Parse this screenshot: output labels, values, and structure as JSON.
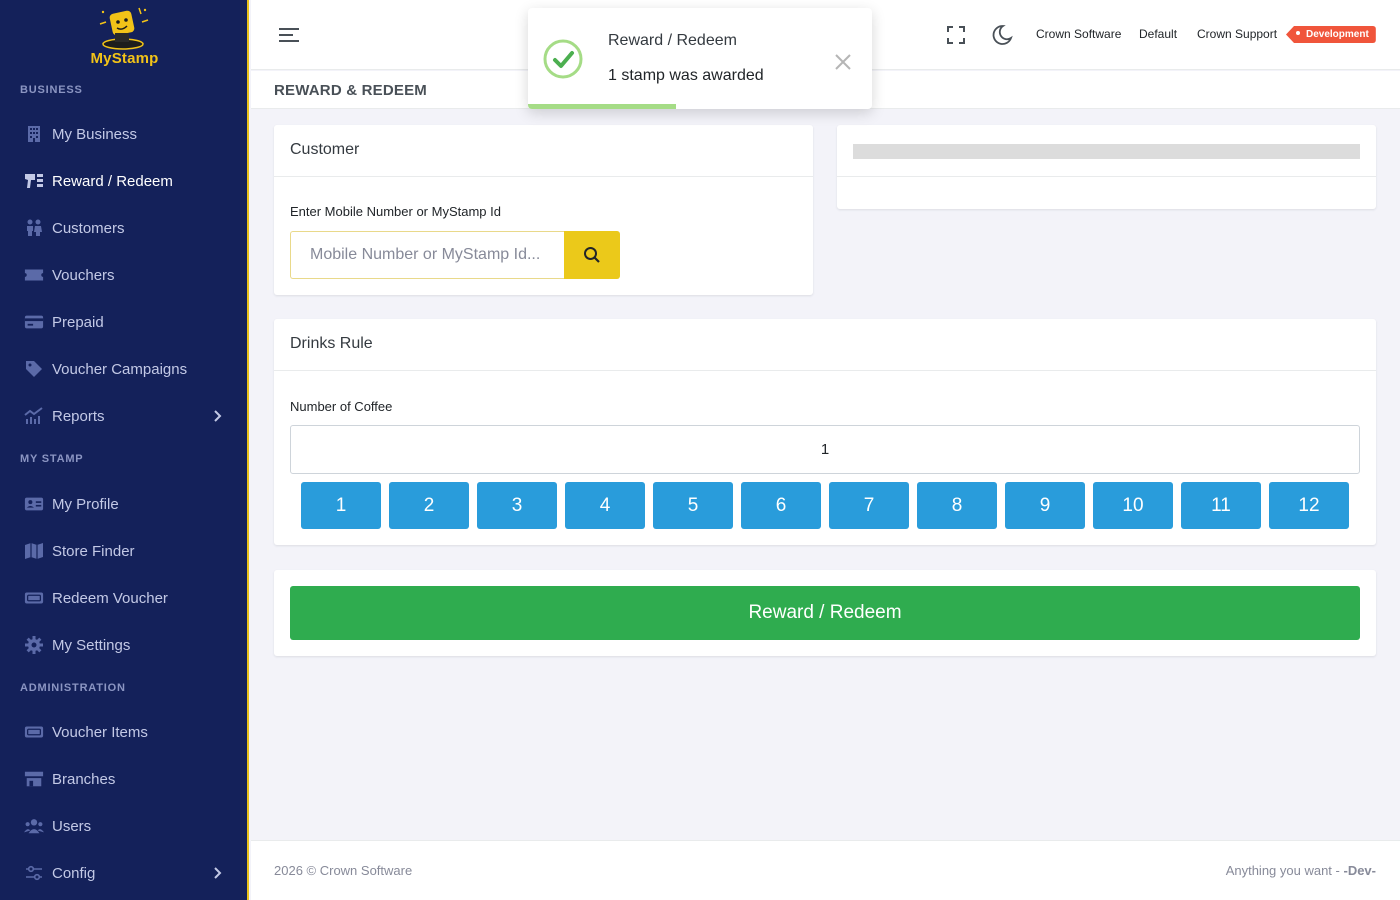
{
  "brand": {
    "name": "MyStamp"
  },
  "sidebar": {
    "sections": [
      {
        "title": "BUSINESS"
      },
      {
        "title": "MY STAMP"
      },
      {
        "title": "ADMINISTRATION"
      }
    ],
    "items": [
      {
        "label": "My Business",
        "icon": "building-icon"
      },
      {
        "label": "Reward / Redeem",
        "icon": "stamp-icon",
        "active": true
      },
      {
        "label": "Customers",
        "icon": "users-icon"
      },
      {
        "label": "Vouchers",
        "icon": "ticket-icon"
      },
      {
        "label": "Prepaid",
        "icon": "credit-card-icon"
      },
      {
        "label": "Voucher Campaigns",
        "icon": "tag-icon"
      },
      {
        "label": "Reports",
        "icon": "chart-icon",
        "has_submenu": true
      },
      {
        "label": "My Profile",
        "icon": "id-card-icon"
      },
      {
        "label": "Store Finder",
        "icon": "map-icon"
      },
      {
        "label": "Redeem Voucher",
        "icon": "ticket-icon"
      },
      {
        "label": "My Settings",
        "icon": "gear-icon"
      },
      {
        "label": "Voucher Items",
        "icon": "ticket-icon"
      },
      {
        "label": "Branches",
        "icon": "store-icon"
      },
      {
        "label": "Users",
        "icon": "users-icon"
      },
      {
        "label": "Config",
        "icon": "sliders-icon",
        "has_submenu": true
      }
    ]
  },
  "topbar": {
    "links": [
      "Crown Software",
      "Default",
      "Crown Support"
    ],
    "badge": "Development"
  },
  "page": {
    "title": "REWARD & REDEEM"
  },
  "customer_card": {
    "title": "Customer",
    "label": "Enter Mobile Number or MyStamp Id",
    "placeholder": "Mobile Number or MyStamp Id..."
  },
  "rule_card": {
    "title": "Drinks Rule",
    "label": "Number of Coffee",
    "value": "1",
    "options": [
      "1",
      "2",
      "3",
      "4",
      "5",
      "6",
      "7",
      "8",
      "9",
      "10",
      "11",
      "12"
    ]
  },
  "submit": {
    "label": "Reward / Redeem"
  },
  "toast": {
    "title": "Reward / Redeem",
    "message": "1 stamp was awarded",
    "progress": 0.43
  },
  "footer": {
    "left": "2026 © Crown Software",
    "right": "Anything you want - ",
    "right_bold": "-Dev-"
  },
  "colors": {
    "sidebar_bg": "#14215a",
    "accent_yellow": "#ebc91a",
    "number_blue": "#299cdb",
    "submit_green": "#2fac4f",
    "badge_red": "#f0553b"
  }
}
